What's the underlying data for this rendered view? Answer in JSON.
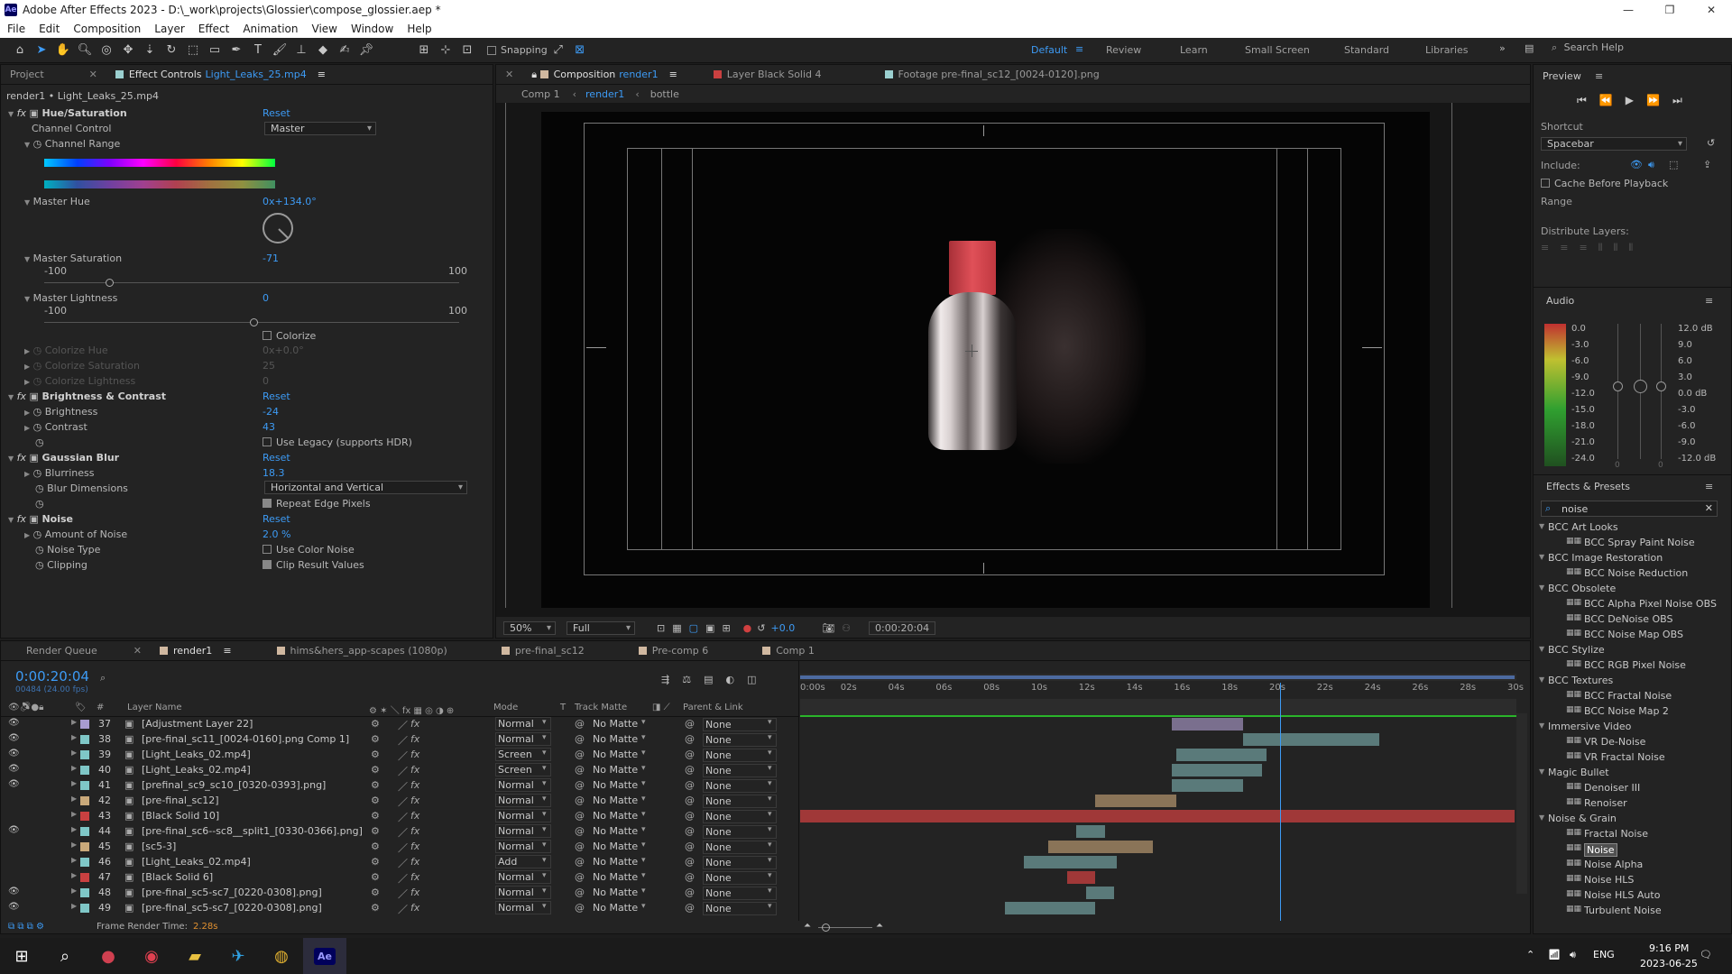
{
  "window": {
    "title": "Adobe After Effects 2023 - D:\\_work\\projects\\Glossier\\compose_glossier.aep *",
    "app_icon": "Ae"
  },
  "menu": [
    "File",
    "Edit",
    "Composition",
    "Layer",
    "Effect",
    "Animation",
    "View",
    "Window",
    "Help"
  ],
  "toolbar": {
    "snapping": "Snapping"
  },
  "workspaces": [
    "Default",
    "Review",
    "Learn",
    "Small Screen",
    "Standard",
    "Libraries"
  ],
  "search_help": "Search Help",
  "effect_controls": {
    "tab_project": "Project",
    "tab_label": "Effect Controls",
    "tab_file": "Light_Leaks_25.mp4",
    "layer_path": "render1 • Light_Leaks_25.mp4",
    "hue_sat": {
      "name": "Hue/Saturation",
      "reset": "Reset",
      "channel_control_label": "Channel Control",
      "channel_control_value": "Master",
      "channel_range": "Channel Range",
      "master_hue": "Master Hue",
      "master_hue_value": "0x+134.0°",
      "master_sat": "Master Saturation",
      "master_sat_value": "-71",
      "sat_min": "-100",
      "sat_max": "100",
      "master_light": "Master Lightness",
      "master_light_value": "0",
      "light_min": "-100",
      "light_max": "100",
      "colorize": "Colorize",
      "colorize_hue": "Colorize Hue",
      "colorize_hue_value": "0x+0.0°",
      "colorize_sat": "Colorize Saturation",
      "colorize_sat_value": "25",
      "colorize_light": "Colorize Lightness",
      "colorize_light_value": "0"
    },
    "brightness": {
      "name": "Brightness & Contrast",
      "reset": "Reset",
      "brightness_label": "Brightness",
      "brightness_value": "-24",
      "contrast_label": "Contrast",
      "contrast_value": "43",
      "legacy": "Use Legacy (supports HDR)"
    },
    "blur": {
      "name": "Gaussian Blur",
      "reset": "Reset",
      "blurriness_label": "Blurriness",
      "blurriness_value": "18.3",
      "dimensions_label": "Blur Dimensions",
      "dimensions_value": "Horizontal and Vertical",
      "repeat": "Repeat Edge Pixels"
    },
    "noise": {
      "name": "Noise",
      "reset": "Reset",
      "amount_label": "Amount of Noise",
      "amount_value": "2.0 %",
      "type_label": "Noise Type",
      "type_value": "Use Color Noise",
      "clipping_label": "Clipping",
      "clipping_value": "Clip Result Values"
    }
  },
  "composition": {
    "tab_label": "Composition",
    "tab_name": "render1",
    "layer_tab": "Layer  Black Solid 4",
    "footage_tab": "Footage  pre-final_sc12_[0024-0120].png",
    "breadcrumbs": [
      "Comp 1",
      "render1",
      "bottle"
    ],
    "zoom": "50%",
    "resolution": "Full",
    "exposure": "+0.0",
    "timecode": "0:00:20:04"
  },
  "preview": {
    "title": "Preview",
    "shortcut_label": "Shortcut",
    "shortcut_value": "Spacebar",
    "include_label": "Include:",
    "cache": "Cache Before Playback",
    "range": "Range",
    "distribute": "Distribute Layers:"
  },
  "audio": {
    "title": "Audio",
    "left_scale": [
      "0.0",
      "-3.0",
      "-6.0",
      "-9.0",
      "-12.0",
      "-15.0",
      "-18.0",
      "-21.0",
      "-24.0"
    ],
    "right_scale": [
      "12.0 dB",
      "9.0",
      "6.0",
      "3.0",
      "0.0 dB",
      "-3.0",
      "-6.0",
      "-9.0",
      "-12.0 dB"
    ],
    "zero_l": "0",
    "zero_r": "0"
  },
  "effects_presets": {
    "title": "Effects & Presets",
    "search": "noise",
    "items": [
      {
        "type": "cat",
        "label": "BCC Art Looks"
      },
      {
        "type": "item",
        "label": "BCC Spray Paint Noise"
      },
      {
        "type": "cat",
        "label": "BCC Image Restoration"
      },
      {
        "type": "item",
        "label": "BCC Noise Reduction"
      },
      {
        "type": "cat",
        "label": "BCC Obsolete"
      },
      {
        "type": "item",
        "label": "BCC Alpha Pixel Noise OBS"
      },
      {
        "type": "item",
        "label": "BCC DeNoise OBS"
      },
      {
        "type": "item",
        "label": "BCC Noise Map OBS"
      },
      {
        "type": "cat",
        "label": "BCC Stylize"
      },
      {
        "type": "item",
        "label": "BCC RGB Pixel Noise"
      },
      {
        "type": "cat",
        "label": "BCC Textures"
      },
      {
        "type": "item",
        "label": "BCC Fractal Noise"
      },
      {
        "type": "item",
        "label": "BCC Noise Map 2"
      },
      {
        "type": "cat",
        "label": "Immersive Video"
      },
      {
        "type": "item",
        "label": "VR De-Noise"
      },
      {
        "type": "item",
        "label": "VR Fractal Noise"
      },
      {
        "type": "cat",
        "label": "Magic Bullet"
      },
      {
        "type": "item",
        "label": "Denoiser III"
      },
      {
        "type": "item",
        "label": "Renoiser"
      },
      {
        "type": "cat",
        "label": "Noise & Grain"
      },
      {
        "type": "item",
        "label": "Fractal Noise"
      },
      {
        "type": "item",
        "label": "Noise",
        "selected": true
      },
      {
        "type": "item",
        "label": "Noise Alpha"
      },
      {
        "type": "item",
        "label": "Noise HLS"
      },
      {
        "type": "item",
        "label": "Noise HLS Auto"
      },
      {
        "type": "item",
        "label": "Turbulent Noise"
      }
    ]
  },
  "timeline": {
    "tabs": [
      "Render Queue",
      "render1",
      "hims&hers_app-scapes (1080p)",
      "pre-final_sc12",
      "Pre-comp 6",
      "Comp 1"
    ],
    "timecode": "0:00:20:04",
    "frame_info": "00484 (24.00 fps)",
    "columns": {
      "layer_name": "Layer Name",
      "mode": "Mode",
      "t": "T",
      "track_matte": "Track Matte",
      "parent": "Parent & Link",
      "num": "#"
    },
    "ruler": [
      "0:00s",
      "02s",
      "04s",
      "06s",
      "08s",
      "10s",
      "12s",
      "14s",
      "16s",
      "18s",
      "20s",
      "22s",
      "24s",
      "26s",
      "28s",
      "30s"
    ],
    "footer": "Frame Render Time:",
    "render_time": "2.28s",
    "layers": [
      {
        "num": "37",
        "name": "[Adjustment Layer 22]",
        "color": "#a89bd0",
        "mode": "Normal",
        "matte": "No Matte",
        "parent": "None",
        "bar_start": 15.6,
        "bar_end": 18.6,
        "bar_color": "#7a6f8e"
      },
      {
        "num": "38",
        "name": "[pre-final_sc11_[0024-0160].png Comp 1]",
        "color": "#7fc7c7",
        "mode": "Normal",
        "matte": "No Matte",
        "parent": "None",
        "bar_start": 18.6,
        "bar_end": 24.3,
        "bar_color": "#5a7a7a"
      },
      {
        "num": "39",
        "name": "[Light_Leaks_02.mp4]",
        "color": "#7fc7c7",
        "mode": "Screen",
        "matte": "No Matte",
        "parent": "None",
        "bar_start": 15.8,
        "bar_end": 19.6,
        "bar_color": "#5a7a7a"
      },
      {
        "num": "40",
        "name": "[Light_Leaks_02.mp4]",
        "color": "#7fc7c7",
        "mode": "Screen",
        "matte": "No Matte",
        "parent": "None",
        "bar_start": 15.6,
        "bar_end": 19.4,
        "bar_color": "#5a7a7a"
      },
      {
        "num": "41",
        "name": "[prefinal_sc9_sc10_[0320-0393].png]",
        "color": "#7fc7c7",
        "mode": "Normal",
        "matte": "No Matte",
        "parent": "None",
        "bar_start": 15.6,
        "bar_end": 18.6,
        "bar_color": "#5a7a7a"
      },
      {
        "num": "42",
        "name": "[pre-final_sc12]",
        "color": "#c9a97a",
        "mode": "Normal",
        "matte": "No Matte",
        "parent": "None",
        "bar_start": 12.4,
        "bar_end": 15.8,
        "bar_color": "#8a7458"
      },
      {
        "num": "43",
        "name": "[Black Solid 10]",
        "color": "#c94040",
        "mode": "Normal",
        "matte": "No Matte",
        "parent": "None",
        "bar_start": 0,
        "bar_end": 30,
        "bar_color": "#a03838"
      },
      {
        "num": "44",
        "name": "[pre-final_sc6--sc8__split1_[0330-0366].png]",
        "color": "#7fc7c7",
        "mode": "Normal",
        "matte": "No Matte",
        "parent": "None",
        "bar_start": 11.6,
        "bar_end": 12.8,
        "bar_color": "#5a7a7a"
      },
      {
        "num": "45",
        "name": "[sc5-3]",
        "color": "#c9a97a",
        "mode": "Normal",
        "matte": "No Matte",
        "parent": "None",
        "bar_start": 10.4,
        "bar_end": 14.8,
        "bar_color": "#8a7458"
      },
      {
        "num": "46",
        "name": "[Light_Leaks_02.mp4]",
        "color": "#7fc7c7",
        "mode": "Add",
        "matte": "No Matte",
        "parent": "None",
        "bar_start": 9.4,
        "bar_end": 13.3,
        "bar_color": "#5a7a7a"
      },
      {
        "num": "47",
        "name": "[Black Solid 6]",
        "color": "#c94040",
        "mode": "Normal",
        "matte": "No Matte",
        "parent": "None",
        "bar_start": 11.2,
        "bar_end": 12.4,
        "bar_color": "#a03838"
      },
      {
        "num": "48",
        "name": "[pre-final_sc5-sc7_[0220-0308].png]",
        "color": "#7fc7c7",
        "mode": "Normal",
        "matte": "No Matte",
        "parent": "None",
        "bar_start": 12.0,
        "bar_end": 13.2,
        "bar_color": "#5a7a7a"
      },
      {
        "num": "49",
        "name": "[pre-final_sc5-sc7_[0220-0308].png]",
        "color": "#7fc7c7",
        "mode": "Normal",
        "matte": "No Matte",
        "parent": "None",
        "bar_start": 8.6,
        "bar_end": 12.4,
        "bar_color": "#5a7a7a"
      }
    ]
  },
  "taskbar": {
    "time": "9:16 PM",
    "date": "2023-06-25",
    "lang": "ENG"
  }
}
